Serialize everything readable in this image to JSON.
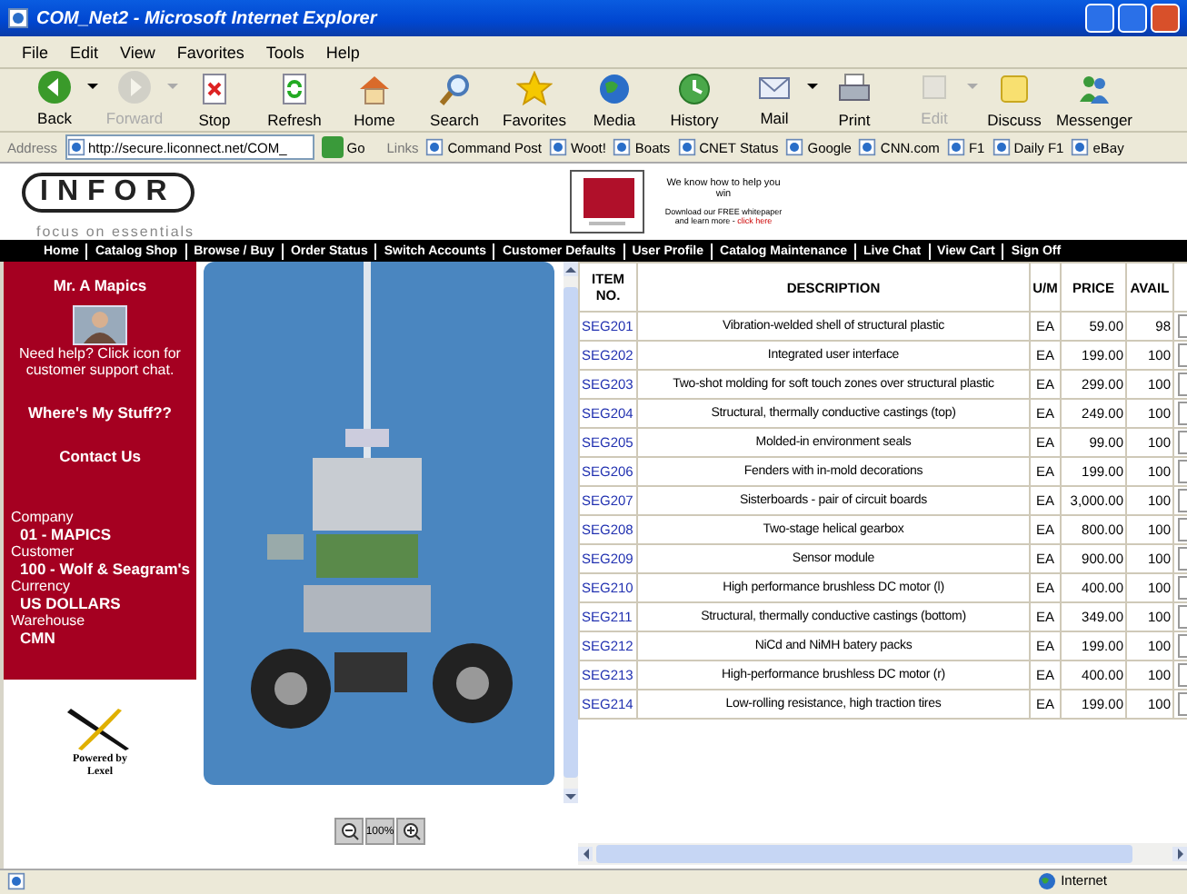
{
  "window": {
    "title": "COM_Net2 - Microsoft Internet Explorer"
  },
  "menu": [
    "File",
    "Edit",
    "View",
    "Favorites",
    "Tools",
    "Help"
  ],
  "toolbar": [
    {
      "label": "Back",
      "kind": "back",
      "disabled": false,
      "dropdown": true
    },
    {
      "label": "Forward",
      "kind": "forward",
      "disabled": true,
      "dropdown": true
    },
    {
      "label": "Stop",
      "kind": "stop",
      "disabled": false,
      "dropdown": false
    },
    {
      "label": "Refresh",
      "kind": "refresh",
      "disabled": false,
      "dropdown": false
    },
    {
      "label": "Home",
      "kind": "home",
      "disabled": false,
      "dropdown": false
    },
    {
      "label": "Search",
      "kind": "search",
      "disabled": false,
      "dropdown": false
    },
    {
      "label": "Favorites",
      "kind": "favorites",
      "disabled": false,
      "dropdown": false
    },
    {
      "label": "Media",
      "kind": "media",
      "disabled": false,
      "dropdown": false
    },
    {
      "label": "History",
      "kind": "history",
      "disabled": false,
      "dropdown": false
    },
    {
      "label": "Mail",
      "kind": "mail",
      "disabled": false,
      "dropdown": true
    },
    {
      "label": "Print",
      "kind": "print",
      "disabled": false,
      "dropdown": false
    },
    {
      "label": "Edit",
      "kind": "edit",
      "disabled": true,
      "dropdown": true
    },
    {
      "label": "Discuss",
      "kind": "discuss",
      "disabled": false,
      "dropdown": false
    },
    {
      "label": "Messenger",
      "kind": "messenger",
      "disabled": false,
      "dropdown": false
    }
  ],
  "address": {
    "label": "Address",
    "value": "http://secure.liconnect.net/COM_",
    "go": "Go"
  },
  "links": {
    "label": "Links",
    "items": [
      "Command Post",
      "Woot!",
      "Boats",
      "CNET Status",
      "Google",
      "CNN.com",
      "F1",
      "Daily F1",
      "eBay"
    ]
  },
  "site": {
    "logo": "INFOR",
    "tagline": "focus on essentials",
    "ad": {
      "headline": "We know how to help you win",
      "body": "Download our FREE whitepaper and learn more - ",
      "link": "click here"
    }
  },
  "nav": [
    "Home",
    "Catalog Shop",
    "Browse / Buy",
    "Order Status",
    "Switch Accounts",
    "Customer Defaults",
    "User Profile",
    "Catalog Maintenance",
    "Live Chat",
    "View Cart",
    "Sign Off"
  ],
  "sidebar": {
    "user": "Mr. A Mapics",
    "help": "Need help? Click icon for customer support chat.",
    "links": [
      "Where's My Stuff??",
      "Contact Us"
    ],
    "fields": [
      {
        "label": "Company",
        "value": "01 - MAPICS"
      },
      {
        "label": "Customer",
        "value": "100 - Wolf & Seagram's"
      },
      {
        "label": "Currency",
        "value": "US DOLLARS"
      },
      {
        "label": "Warehouse",
        "value": "CMN"
      }
    ],
    "powered": [
      "Powered by",
      "Lexel"
    ]
  },
  "zoom_controls": {
    "reset": "100%"
  },
  "table": {
    "columns": [
      "ITEM NO.",
      "DESCRIPTION",
      "U/M",
      "PRICE",
      "AVAIL"
    ],
    "rows": [
      [
        "SEG201",
        "Vibration-welded shell of structural plastic",
        "EA",
        "59.00",
        "98"
      ],
      [
        "SEG202",
        "Integrated user interface",
        "EA",
        "199.00",
        "100"
      ],
      [
        "SEG203",
        "Two-shot molding for soft touch zones over structural plastic",
        "EA",
        "299.00",
        "100"
      ],
      [
        "SEG204",
        "Structural, thermally conductive castings (top)",
        "EA",
        "249.00",
        "100"
      ],
      [
        "SEG205",
        "Molded-in environment seals",
        "EA",
        "99.00",
        "100"
      ],
      [
        "SEG206",
        "Fenders with in-mold decorations",
        "EA",
        "199.00",
        "100"
      ],
      [
        "SEG207",
        "Sisterboards - pair of circuit boards",
        "EA",
        "3,000.00",
        "100"
      ],
      [
        "SEG208",
        "Two-stage helical gearbox",
        "EA",
        "800.00",
        "100"
      ],
      [
        "SEG209",
        "Sensor module",
        "EA",
        "900.00",
        "100"
      ],
      [
        "SEG210",
        "High performance brushless DC motor (l)",
        "EA",
        "400.00",
        "100"
      ],
      [
        "SEG211",
        "Structural, thermally conductive castings (bottom)",
        "EA",
        "349.00",
        "100"
      ],
      [
        "SEG212",
        "NiCd and NiMH batery packs",
        "EA",
        "199.00",
        "100"
      ],
      [
        "SEG213",
        "High-performance brushless DC motor (r)",
        "EA",
        "400.00",
        "100"
      ],
      [
        "SEG214",
        "Low-rolling resistance, high traction tires",
        "EA",
        "199.00",
        "100"
      ]
    ]
  },
  "status_bar": {
    "zone": "Internet"
  }
}
